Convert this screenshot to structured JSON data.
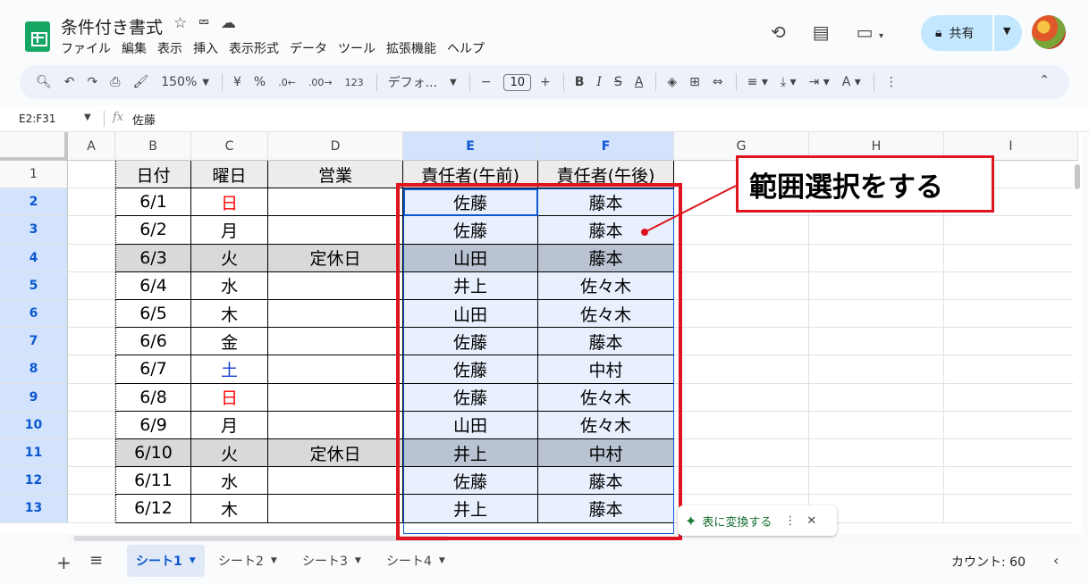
{
  "doc": {
    "title": "条件付き書式",
    "title_icons": [
      "☆",
      "⮹",
      "☁"
    ]
  },
  "menu": [
    "ファイル",
    "編集",
    "表示",
    "挿入",
    "表示形式",
    "データ",
    "ツール",
    "拡張機能",
    "ヘルプ"
  ],
  "header": {
    "history_icon": "⟲",
    "comment_icon": "▤",
    "meet_icon": "▭",
    "share_label": "共有"
  },
  "toolbar": {
    "zoom": "150%",
    "currency": "¥",
    "percent": "%",
    "dec_decrease": ".0←",
    "dec_increase": ".00→",
    "format_123": "123",
    "font": "デフォ...",
    "font_size": "10",
    "bold": "B",
    "italic": "I",
    "strike": "S",
    "text_color": "A"
  },
  "formula_bar": {
    "name_box": "E2:F31",
    "value": "佐藤"
  },
  "columns": [
    "A",
    "B",
    "C",
    "D",
    "E",
    "F",
    "G",
    "H",
    "I"
  ],
  "table_header": {
    "B": "日付",
    "C": "曜日",
    "D": "営業",
    "E": "責任者(午前)",
    "F": "責任者(午後)"
  },
  "rows": [
    {
      "n": "1"
    },
    {
      "n": "2",
      "B": "6/1",
      "C": "日",
      "D": "",
      "E": "佐藤",
      "F": "藤本",
      "day_color": "red"
    },
    {
      "n": "3",
      "B": "6/2",
      "C": "月",
      "D": "",
      "E": "佐藤",
      "F": "藤本"
    },
    {
      "n": "4",
      "B": "6/3",
      "C": "火",
      "D": "定休日",
      "E": "山田",
      "F": "藤本",
      "closed": true
    },
    {
      "n": "5",
      "B": "6/4",
      "C": "水",
      "D": "",
      "E": "井上",
      "F": "佐々木"
    },
    {
      "n": "6",
      "B": "6/5",
      "C": "木",
      "D": "",
      "E": "山田",
      "F": "佐々木"
    },
    {
      "n": "7",
      "B": "6/6",
      "C": "金",
      "D": "",
      "E": "佐藤",
      "F": "藤本"
    },
    {
      "n": "8",
      "B": "6/7",
      "C": "土",
      "D": "",
      "E": "佐藤",
      "F": "中村",
      "day_color": "blue"
    },
    {
      "n": "9",
      "B": "6/8",
      "C": "日",
      "D": "",
      "E": "佐藤",
      "F": "佐々木",
      "day_color": "red"
    },
    {
      "n": "10",
      "B": "6/9",
      "C": "月",
      "D": "",
      "E": "山田",
      "F": "佐々木"
    },
    {
      "n": "11",
      "B": "6/10",
      "C": "火",
      "D": "定休日",
      "E": "井上",
      "F": "中村",
      "closed": true
    },
    {
      "n": "12",
      "B": "6/11",
      "C": "水",
      "D": "",
      "E": "佐藤",
      "F": "藤本"
    },
    {
      "n": "13",
      "B": "6/12",
      "C": "木",
      "D": "",
      "E": "井上",
      "F": "藤本"
    }
  ],
  "callout": "範囲選択をする",
  "convert_chip": "表に変換する",
  "sheets": [
    "シート1",
    "シート2",
    "シート3",
    "シート4"
  ],
  "status": {
    "count": "カウント: 60"
  },
  "colors": {
    "accent": "#0b57d0",
    "annotation_red": "#e0141e",
    "sheets_green": "#16a765"
  }
}
